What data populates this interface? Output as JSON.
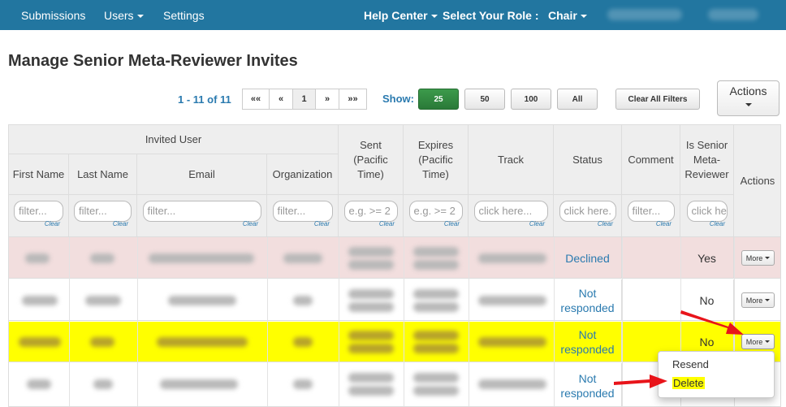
{
  "nav": {
    "submissions": "Submissions",
    "users": "Users",
    "settings": "Settings",
    "help_center": "Help Center",
    "select_role": "Select Your Role :",
    "role": "Chair"
  },
  "page": {
    "title": "Manage Senior Meta-Reviewer Invites"
  },
  "pager": {
    "range": "1 - 11 of 11",
    "first": "««",
    "prev": "«",
    "current": "1",
    "next": "»",
    "last": "»»",
    "show_label": "Show:",
    "sizes": [
      "25",
      "50",
      "100",
      "All"
    ],
    "clear_filters": "Clear All Filters",
    "actions": "Actions"
  },
  "table": {
    "group_header": "Invited User",
    "headers": {
      "first_name": "First Name",
      "last_name": "Last Name",
      "email": "Email",
      "organization": "Organization",
      "sent": "Sent (Pacific Time)",
      "expires": "Expires (Pacific Time)",
      "track": "Track",
      "status": "Status",
      "comment": "Comment",
      "is_senior": "Is Senior Meta-Reviewer",
      "actions": "Actions"
    },
    "filters": {
      "first_name": "filter...",
      "last_name": "filter...",
      "email": "filter...",
      "organization": "filter...",
      "sent": "e.g. >= 2",
      "expires": "e.g. >= 2",
      "track": "click here...",
      "status": "click here.",
      "comment": "filter...",
      "is_senior": "click he",
      "clear": "Clear"
    },
    "rows": [
      {
        "status": "Declined",
        "is_senior": "Yes",
        "more": "More"
      },
      {
        "status": "Not responded",
        "is_senior": "No",
        "more": "More"
      },
      {
        "status": "Not responded",
        "is_senior": "No",
        "more": "More"
      },
      {
        "status": "Not responded",
        "is_senior": "",
        "more": ""
      }
    ]
  },
  "dropdown": {
    "resend": "Resend",
    "delete": "Delete"
  },
  "colors": {
    "navbar": "#2276a0",
    "link": "#2a7aaf",
    "declined_row": "#f2dede",
    "highlight_row": "#ffff00",
    "arrow": "#e8141a"
  }
}
